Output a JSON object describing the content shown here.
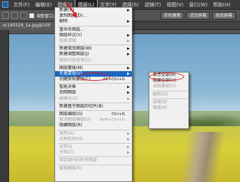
{
  "menubar": {
    "items": [
      {
        "label": "文件(F)"
      },
      {
        "label": "编辑(E)"
      },
      {
        "label": "图像(I)"
      },
      {
        "label": "图层(L)"
      },
      {
        "label": "文字(Y)"
      },
      {
        "label": "选择(S)"
      },
      {
        "label": "滤镜(T)"
      },
      {
        "label": "视图(V)"
      },
      {
        "label": "窗口(W)"
      },
      {
        "label": "帮助(H)"
      }
    ],
    "active_index": 3
  },
  "options": {
    "adjust_window_label": "调整窗口大",
    "actual_pixels": "实际像素",
    "fit_screen": "适合屏幕",
    "fill_screen": "填充屏幕"
  },
  "document": {
    "tab_title": "sc140329_1a.jpg@100"
  },
  "layer_menu": {
    "items": [
      {
        "label": "新建(N)",
        "arrow": true
      },
      {
        "label": "复制图层(D)..."
      },
      {
        "label": "删除",
        "arrow": true
      },
      {
        "sep": true
      },
      {
        "label": "重命名图层..."
      },
      {
        "label": "图层样式(Y)",
        "arrow": true
      },
      {
        "label": "智能滤镜",
        "disabled": true,
        "arrow": true
      },
      {
        "sep": true
      },
      {
        "label": "新建填充图层(W)",
        "arrow": true
      },
      {
        "label": "新建调整图层(J)",
        "arrow": true
      },
      {
        "label": "图层内容选项(O)...",
        "disabled": true
      },
      {
        "sep": true
      },
      {
        "label": "图层蒙版(M)",
        "arrow": true
      },
      {
        "label": "矢量蒙版(V)",
        "arrow": true,
        "highlight": true
      },
      {
        "label": "创建剪贴蒙版(C)",
        "shortcut": "Alt+Ctrl+G"
      },
      {
        "sep": true
      },
      {
        "label": "智能对象",
        "arrow": true
      },
      {
        "label": "视频图层",
        "arrow": true
      },
      {
        "label": "栅格化(Z)",
        "disabled": true,
        "arrow": true
      },
      {
        "sep": true
      },
      {
        "label": "新建基于图层的切片(B)"
      },
      {
        "sep": true
      },
      {
        "label": "图层编组(G)",
        "shortcut": "Ctrl+G"
      },
      {
        "label": "取消图层编组(U)",
        "shortcut": "Shift+Ctrl+G",
        "disabled": true
      },
      {
        "label": "隐藏图层(R)"
      },
      {
        "sep": true
      },
      {
        "label": "排列(A)",
        "disabled": true,
        "arrow": true
      },
      {
        "label": "合并形状(H)",
        "disabled": true,
        "arrow": true
      },
      {
        "sep": true
      },
      {
        "label": "对齐(I)",
        "disabled": true,
        "arrow": true
      },
      {
        "label": "分布(T)",
        "disabled": true,
        "arrow": true
      },
      {
        "sep": true
      },
      {
        "label": "锁定组内的所有图层",
        "disabled": true
      },
      {
        "sep": true
      },
      {
        "label": "链接图层(K)",
        "disabled": true
      }
    ]
  },
  "vector_mask_submenu": {
    "items": [
      {
        "label": "显示全部(R)"
      },
      {
        "label": "隐藏全部(H)"
      },
      {
        "label": "当前路径(U)",
        "disabled": true
      },
      {
        "sep": true
      },
      {
        "label": "删除(D)",
        "disabled": true
      },
      {
        "sep": true
      },
      {
        "label": "启用(B)",
        "disabled": true
      },
      {
        "label": "链接(K)",
        "disabled": true
      }
    ]
  },
  "colors": {
    "highlight": "#1a66c2",
    "annotation": "#e02020"
  }
}
